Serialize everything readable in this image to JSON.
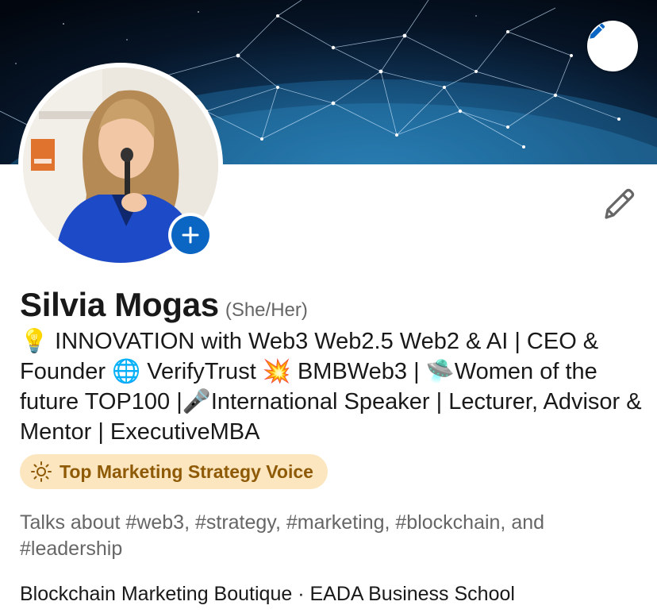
{
  "banner": {
    "edit_icon": "pencil-icon"
  },
  "avatar": {
    "add_icon": "plus-icon"
  },
  "profile": {
    "edit_icon": "pencil-icon",
    "name": "Silvia Mogas",
    "pronouns": "(She/Her)",
    "headline": "💡 INNOVATION with Web3 Web2.5 Web2 & AI | CEO & Founder 🌐 VerifyTrust 💥 BMBWeb3 | 🛸Women of the future TOP100 |🎤International Speaker | Lecturer, Advisor & Mentor | ExecutiveMBA",
    "badge": {
      "icon": "sun-icon",
      "label": "Top Marketing Strategy Voice"
    },
    "talks_about": "Talks about #web3, #strategy, #marketing, #blockchain, and #leadership",
    "companies": "Blockchain Marketing Boutique · EADA Business School"
  },
  "colors": {
    "accent": "#0a66c2",
    "badge_bg": "#fbe6c0",
    "badge_text": "#8f5a05",
    "secondary_text": "#666666"
  }
}
